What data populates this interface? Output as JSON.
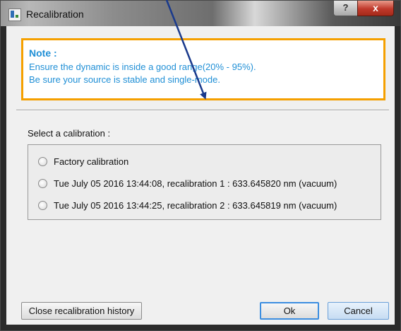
{
  "window": {
    "title": "Recalibration",
    "help_label": "?",
    "close_label": "x"
  },
  "note": {
    "title": "Note :",
    "line1": "Ensure the dynamic is inside a good range(20% - 95%).",
    "line2": "Be sure your source is stable and single-mode."
  },
  "calibration": {
    "label": "Select a calibration :",
    "options": [
      {
        "label": "Factory calibration",
        "selected": false
      },
      {
        "label": "Tue July 05 2016 13:44:08, recalibration 1 : 633.645820  nm (vacuum)",
        "selected": false
      },
      {
        "label": "Tue July 05 2016 13:44:25, recalibration 2 : 633.645819  nm (vacuum)",
        "selected": false
      }
    ]
  },
  "buttons": {
    "close_history": "Close recalibration history",
    "ok": "Ok",
    "cancel": "Cancel"
  },
  "colors": {
    "note_border": "#f5a000",
    "note_text": "#1f8fd6",
    "annotation_arrow": "#1a3a8c"
  }
}
